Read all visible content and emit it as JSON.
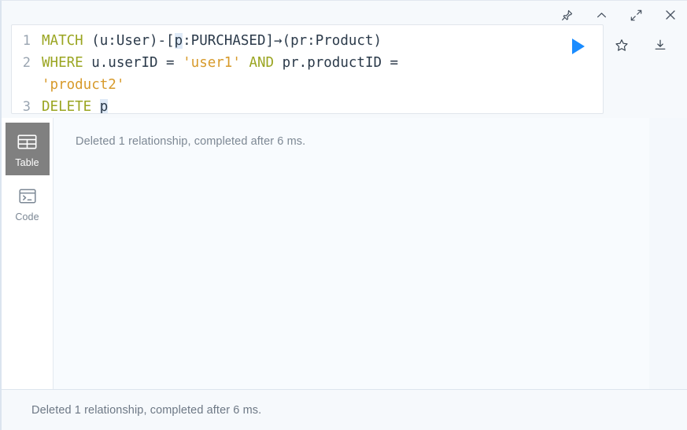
{
  "window_controls": [
    {
      "name": "pin-icon",
      "label": "Pin"
    },
    {
      "name": "chevron-up-icon",
      "label": "Collapse"
    },
    {
      "name": "expand-icon",
      "label": "Expand"
    },
    {
      "name": "close-icon",
      "label": "Close"
    }
  ],
  "editor": {
    "language": "cypher",
    "run_label": "Run",
    "lines": [
      {
        "number": "1",
        "tokens": [
          {
            "text": "MATCH",
            "type": "keyword"
          },
          {
            "text": " (u:User)-[",
            "type": "plain"
          },
          {
            "text": "p",
            "type": "highlight"
          },
          {
            "text": ":PURCHASED]→(pr:Product)",
            "type": "plain"
          }
        ]
      },
      {
        "number": "2",
        "tokens": [
          {
            "text": "WHERE",
            "type": "keyword"
          },
          {
            "text": " u.userID = ",
            "type": "plain"
          },
          {
            "text": "'user1'",
            "type": "string"
          },
          {
            "text": " ",
            "type": "plain"
          },
          {
            "text": "AND",
            "type": "keyword"
          },
          {
            "text": " pr.productID =",
            "type": "plain"
          }
        ]
      },
      {
        "number": "",
        "tokens": [
          {
            "text": "'product2'",
            "type": "string"
          }
        ]
      },
      {
        "number": "3",
        "tokens": [
          {
            "text": "DELETE",
            "type": "keyword"
          },
          {
            "text": " ",
            "type": "plain"
          },
          {
            "text": "p",
            "type": "highlight"
          }
        ]
      }
    ],
    "side_actions": [
      {
        "name": "star-icon",
        "label": "Favorite"
      },
      {
        "name": "download-icon",
        "label": "Download"
      }
    ]
  },
  "view_tabs": [
    {
      "name": "table",
      "label": "Table",
      "icon": "table-icon",
      "active": true
    },
    {
      "name": "code",
      "label": "Code",
      "icon": "terminal-icon",
      "active": false
    }
  ],
  "result": {
    "message": "Deleted 1 relationship, completed after 6 ms."
  },
  "status": {
    "message": "Deleted 1 relationship, completed after 6 ms."
  },
  "colors": {
    "accent_blue": "#1a8cff",
    "keyword": "#9aa521",
    "string": "#d79a2b",
    "plain": "#2b3a4a",
    "tab_active_bg": "#808080",
    "panel_bg": "#f8fbfe"
  }
}
